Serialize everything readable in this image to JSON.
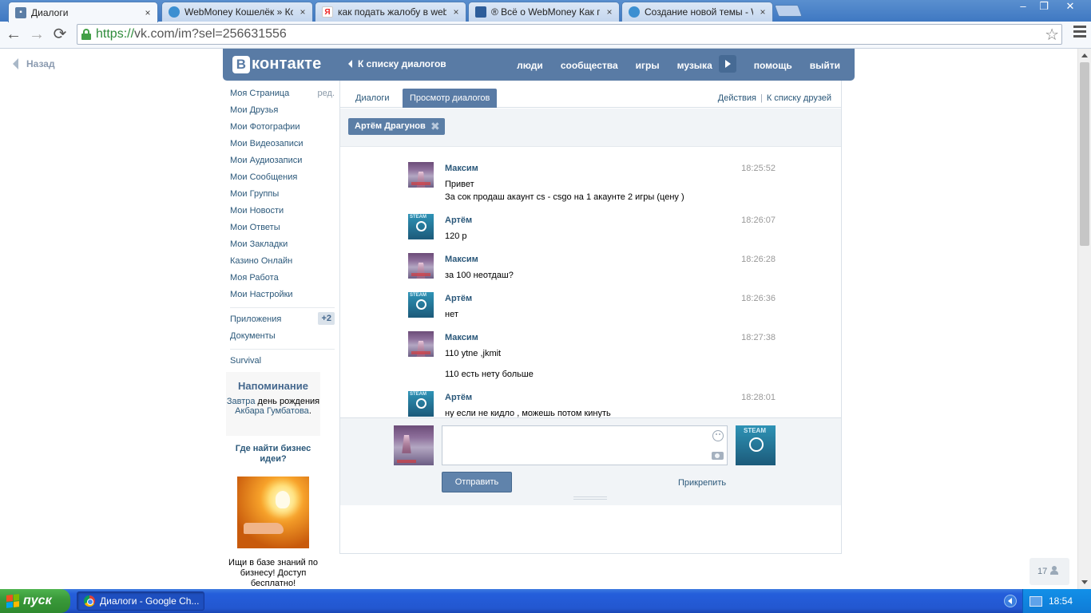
{
  "browser": {
    "tabs": [
      {
        "label": "Диалоги",
        "icon": "vk-message-icon",
        "active": true
      },
      {
        "label": "WebMoney Кошелёк » Коше",
        "icon": "globe-icon"
      },
      {
        "label": "как подать жалобу в webm",
        "icon": "yandex-icon"
      },
      {
        "label": "® Всё о WebMoney Как п",
        "icon": "monitor-icon"
      },
      {
        "label": "Создание новой темы - We",
        "icon": "globe-icon"
      }
    ],
    "tab_close": "×",
    "url_scheme": "https://",
    "url_rest": "vk.com/im?sel=256631556",
    "back": "←",
    "forward": "→",
    "reload": "⟳",
    "star": "☆",
    "window_controls": [
      "–",
      "❐",
      "✕"
    ]
  },
  "page_back": "Назад",
  "header": {
    "logo_letter": "В",
    "logo_text": "контакте",
    "back_to_list": "К списку диалогов",
    "nav": [
      "люди",
      "сообщества",
      "игры",
      "музыка",
      "помощь",
      "выйти"
    ]
  },
  "sidebar": {
    "items": [
      {
        "label": "Моя Страница",
        "extra": "ред."
      },
      {
        "label": "Мои Друзья"
      },
      {
        "label": "Мои Фотографии"
      },
      {
        "label": "Мои Видеозаписи"
      },
      {
        "label": "Мои Аудиозаписи"
      },
      {
        "label": "Мои Сообщения"
      },
      {
        "label": "Мои Группы"
      },
      {
        "label": "Мои Новости"
      },
      {
        "label": "Мои Ответы"
      },
      {
        "label": "Мои Закладки"
      },
      {
        "label": "Казино Онлайн"
      },
      {
        "label": "Моя Работа"
      },
      {
        "label": "Мои Настройки"
      }
    ],
    "apps": {
      "label": "Приложения",
      "badge": "+2"
    },
    "docs": "Документы",
    "survival": "Survival"
  },
  "reminder": {
    "title": "Напоминание",
    "link1": "Завтра",
    "text1": " день рождения ",
    "link2": "Акбара Гумбатова",
    "text2": "."
  },
  "ad": {
    "title": "Где найти бизнес идеи?",
    "text": "Ищи в базе знаний по бизнесу! Доступ бесплатно!"
  },
  "dialog": {
    "tabs": [
      "Диалоги",
      "Просмотр диалогов"
    ],
    "actions": "Действия",
    "friends_list": "К списку друзей",
    "filter_chip": "Артём Драгунов",
    "chip_close": "✖",
    "messages": [
      {
        "author": "Максим",
        "time": "18:25:52",
        "lines": [
          "Привет",
          "За сок продаш акаунт cs - csgo на 1 акаунте 2 игры (цену )"
        ],
        "avatar": "max"
      },
      {
        "author": "Артём",
        "time": "18:26:07",
        "lines": [
          "120 р"
        ],
        "avatar": "steam"
      },
      {
        "author": "Максим",
        "time": "18:26:28",
        "lines": [
          "за 100 неотдаш?"
        ],
        "avatar": "max"
      },
      {
        "author": "Артём",
        "time": "18:26:36",
        "lines": [
          "нет"
        ],
        "avatar": "steam"
      },
      {
        "author": "Максим",
        "time": "18:27:38",
        "lines": [
          "110 ytne ,jkmit",
          "",
          "110 есть нету больше"
        ],
        "avatar": "max"
      },
      {
        "author": "Артём",
        "time": "18:28:01",
        "lines": [
          "ну если не кидло , можешь потом кинуть"
        ],
        "avatar": "steam"
      }
    ],
    "steam_label": "STEAM",
    "send_button": "Отправить",
    "attach": "Прикрепить",
    "message_value": ""
  },
  "online_count": "17",
  "taskbar": {
    "start": "пуск",
    "window": "Диалоги - Google Ch...",
    "clock": "18:54"
  }
}
